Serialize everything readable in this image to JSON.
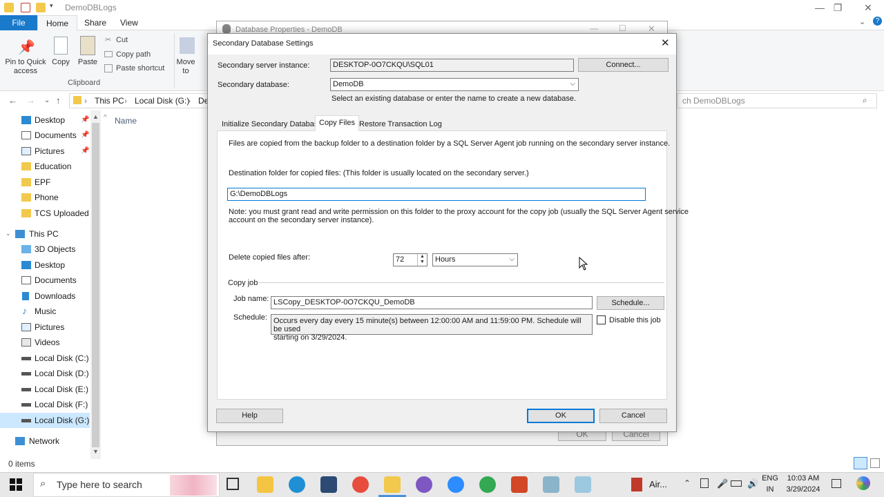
{
  "explorer": {
    "window_title": "DemoDBLogs",
    "tabs": {
      "file": "File",
      "home": "Home",
      "share": "Share",
      "view": "View"
    },
    "ribbon": {
      "pin": "Pin to Quick access",
      "copy": "Copy",
      "paste": "Paste",
      "cut": "Cut",
      "copy_path": "Copy path",
      "paste_shortcut": "Paste shortcut",
      "move_to": "Move to",
      "clipboard_group": "Clipboard"
    },
    "address": {
      "this_pc": "This PC",
      "disk": "Local Disk (G:)",
      "trunc": "De"
    },
    "search_placeholder": "ch DemoDBLogs",
    "column_name": "Name",
    "nav": {
      "quick": [
        {
          "label": "Desktop"
        },
        {
          "label": "Documents"
        },
        {
          "label": "Pictures"
        },
        {
          "label": "Education"
        },
        {
          "label": "EPF"
        },
        {
          "label": "Phone"
        },
        {
          "label": "TCS Uploaded D"
        }
      ],
      "this_pc": "This PC",
      "pc_items": [
        {
          "label": "3D Objects"
        },
        {
          "label": "Desktop"
        },
        {
          "label": "Documents"
        },
        {
          "label": "Downloads"
        },
        {
          "label": "Music"
        },
        {
          "label": "Pictures"
        },
        {
          "label": "Videos"
        },
        {
          "label": "Local Disk (C:)"
        },
        {
          "label": "Local Disk (D:)"
        },
        {
          "label": "Local Disk (E:)"
        },
        {
          "label": "Local Disk (F:)"
        },
        {
          "label": "Local Disk (G:)"
        }
      ],
      "network": "Network"
    },
    "status": "0 items"
  },
  "db_properties": {
    "title": "Database Properties - DemoDB",
    "ok": "OK",
    "cancel": "Cancel"
  },
  "dialog": {
    "title": "Secondary Database Settings",
    "server_label": "Secondary server instance:",
    "server_value": "DESKTOP-0O7CKQU\\SQL01",
    "connect_button": "Connect...",
    "database_label": "Secondary database:",
    "database_value": "DemoDB",
    "database_hint": "Select an existing database or enter the name to create a new database.",
    "tabs": {
      "init": "Initialize Secondary Database",
      "copy": "Copy Files",
      "restore": "Restore Transaction Log"
    },
    "copy_files": {
      "description": "Files are copied from the backup folder to a destination folder by a SQL Server Agent job running on the secondary server instance.",
      "dest_label": "Destination folder for copied files: (This folder is usually located on the secondary server.)",
      "dest_value": "G:\\DemoDBLogs",
      "note_line1": "Note: you must grant read and write permission on this folder to the proxy account for the copy job (usually the SQL Server Agent service",
      "note_line2": "account on the secondary server instance).",
      "delete_label": "Delete copied files after:",
      "delete_value": "72",
      "delete_unit": "Hours",
      "copy_job_group": "Copy job",
      "job_name_label": "Job name:",
      "job_name_value": "LSCopy_DESKTOP-0O7CKQU_DemoDB",
      "schedule_button": "Schedule...",
      "schedule_label": "Schedule:",
      "schedule_line1": "Occurs every day every 15 minute(s) between 12:00:00 AM and 11:59:00 PM. Schedule will be used",
      "schedule_line2": "starting on 3/29/2024.",
      "disable_label": "Disable this job"
    },
    "help_button": "Help",
    "ok_button": "OK",
    "cancel_button": "Cancel"
  },
  "taskbar": {
    "search_placeholder": "Type here to search",
    "airline_label": "Air...",
    "lang_top": "ENG",
    "lang_bottom": "IN",
    "time": "10:03 AM",
    "date": "3/29/2024"
  }
}
